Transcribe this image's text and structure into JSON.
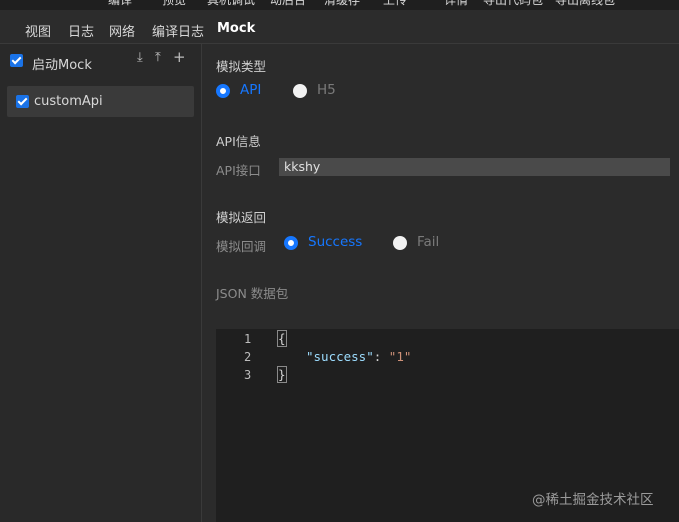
{
  "top_menu": [
    "编译",
    "预览",
    "真机调试",
    "动后台",
    "清缓存",
    "上传",
    "详情",
    "导出代码包",
    "导出离线包"
  ],
  "tabs": [
    "视图",
    "日志",
    "网络",
    "编译日志",
    "Mock"
  ],
  "sidebar": {
    "enable_label": "启动Mock",
    "enabled": true,
    "icons": [
      "download-icon",
      "upload-icon",
      "plus-icon"
    ],
    "items": [
      {
        "label": "customApi",
        "checked": true
      }
    ]
  },
  "mock_type": {
    "title": "模拟类型",
    "options": [
      {
        "label": "API",
        "selected": true
      },
      {
        "label": "H5",
        "selected": false
      }
    ]
  },
  "api_info": {
    "title": "API信息",
    "field_label": "API接口",
    "value": "kkshy"
  },
  "mock_return": {
    "title": "模拟返回",
    "callback_label": "模拟回调",
    "options": [
      {
        "label": "Success",
        "selected": true
      },
      {
        "label": "Fail",
        "selected": false
      }
    ]
  },
  "json_label": "JSON 数据包",
  "editor": {
    "line_numbers": [
      "1",
      "2",
      "3"
    ],
    "line1": "{",
    "key": "\"success\"",
    "colon": ": ",
    "value": "\"1\"",
    "line3": "}"
  },
  "watermark": "@稀土掘金技术社区",
  "colors": {
    "accent": "#1677ff",
    "background": "#2b2b2b",
    "editor_bg": "#1f1f1f"
  }
}
